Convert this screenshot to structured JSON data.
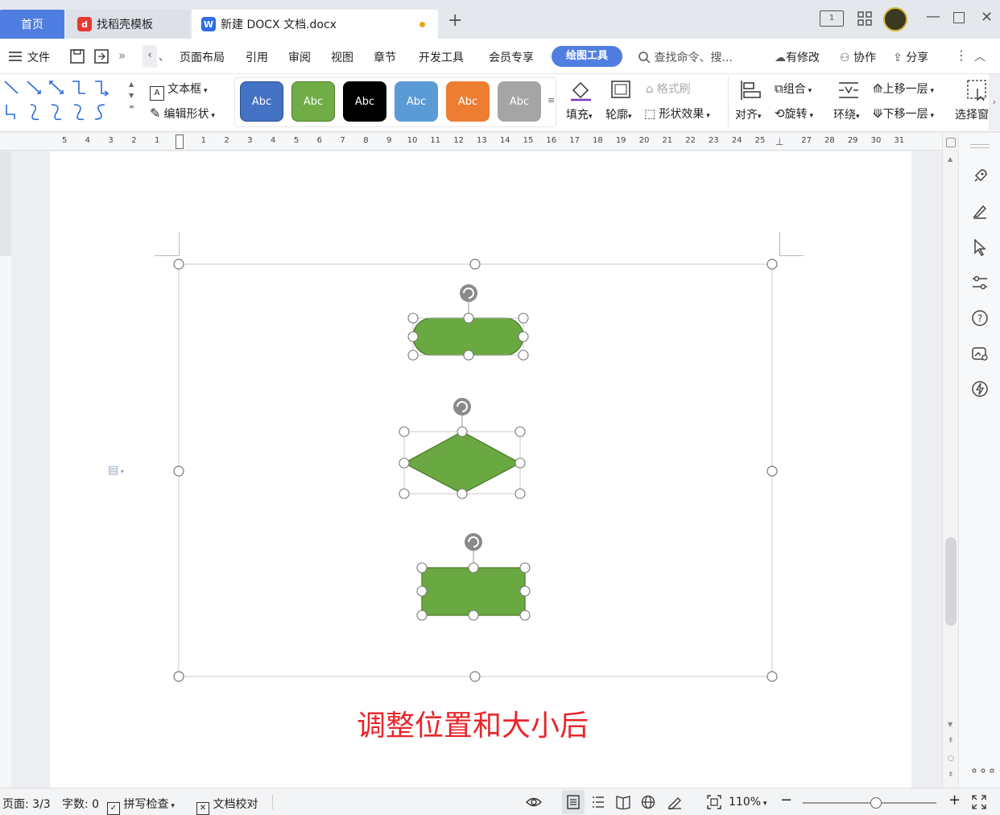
{
  "tabs": {
    "home": "首页",
    "template": "找稻壳模板",
    "document": "新建 DOCX 文档.docx",
    "new_tab": "+"
  },
  "menu": {
    "file": "文件",
    "items": [
      "页面布局",
      "引用",
      "审阅",
      "视图",
      "章节",
      "开发工具",
      "会员专享"
    ],
    "active": "绘图工具",
    "search": "查找命令、搜...",
    "modified": "有修改",
    "collab": "协作",
    "share": "分享"
  },
  "ribbon": {
    "textbox": "文本框",
    "edit_shape": "编辑形状",
    "styles": [
      {
        "label": "Abc",
        "color": "#4472c4"
      },
      {
        "label": "Abc",
        "color": "#70ad47"
      },
      {
        "label": "Abc",
        "color": "#000000"
      },
      {
        "label": "Abc",
        "color": "#5b9bd5"
      },
      {
        "label": "Abc",
        "color": "#ed7d31"
      },
      {
        "label": "Abc",
        "color": "#a5a5a5"
      }
    ],
    "fill": "填充",
    "outline": "轮廓",
    "format_painter": "格式刷",
    "shape_effect": "形状效果",
    "align": "对齐",
    "group": "组合",
    "rotate": "旋转",
    "wrap": "环绕",
    "bring_forward": "上移一层",
    "send_backward": "下移一层",
    "select_pane": "选择窗"
  },
  "ruler": {
    "numbers": [
      "5",
      "4",
      "3",
      "2",
      "1",
      "",
      "1",
      "2",
      "3",
      "4",
      "5",
      "6",
      "7",
      "8",
      "9",
      "10",
      "11",
      "12",
      "13",
      "14",
      "15",
      "16",
      "17",
      "18",
      "19",
      "20",
      "21",
      "22",
      "23",
      "24",
      "25",
      "",
      "27",
      "28",
      "29",
      "30",
      "31"
    ]
  },
  "document": {
    "caption": "调整位置和大小后",
    "shape_color": "#6aa842",
    "caption_color": "#e8262b"
  },
  "status": {
    "page": "页面: 3/3",
    "words": "字数: 0",
    "spell": "拼写检查",
    "proof": "文档校对",
    "zoom": "110%",
    "zoom_level_percent": 55
  }
}
